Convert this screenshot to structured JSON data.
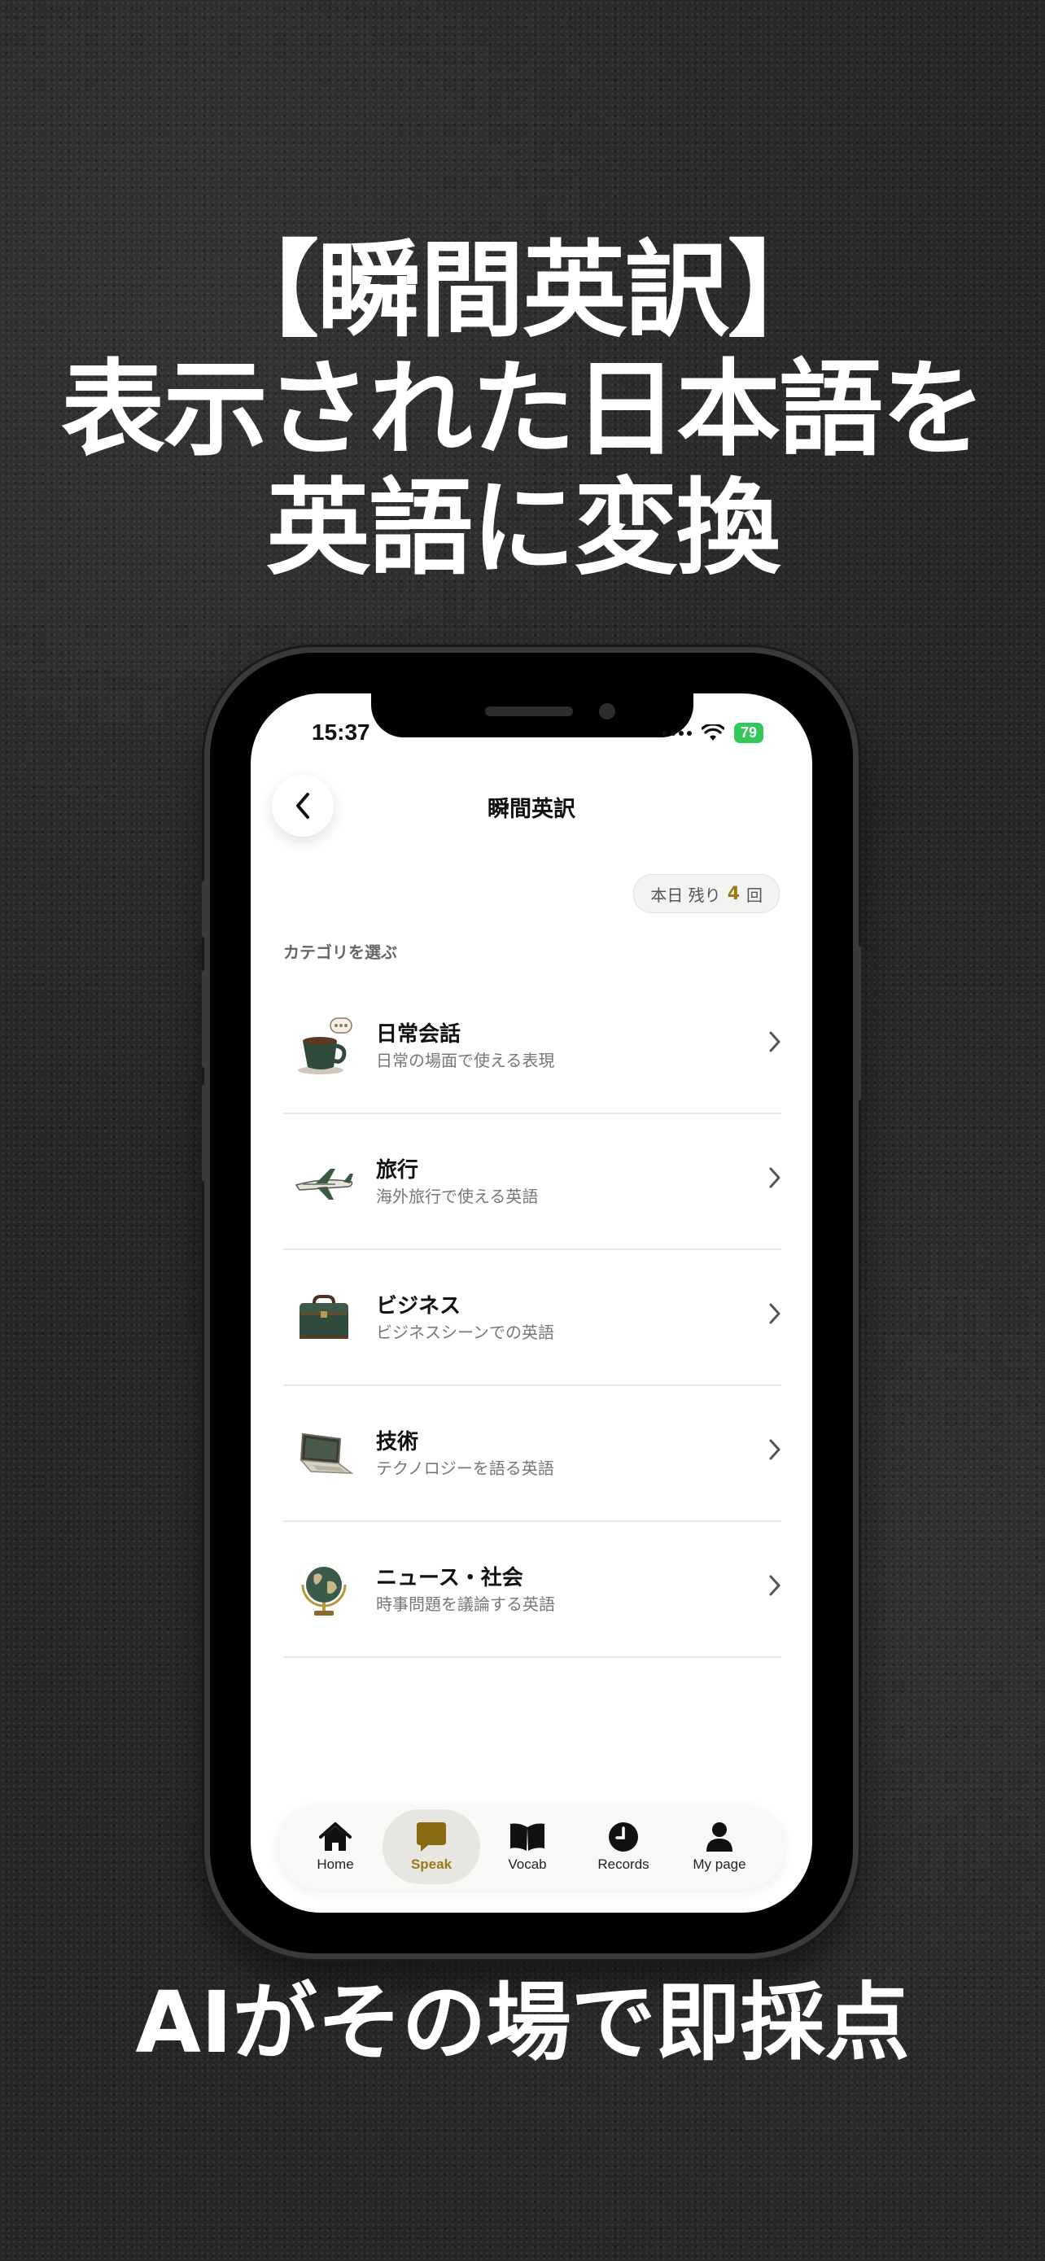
{
  "promo": {
    "headline_lines": [
      "【瞬間英訳】",
      "表示された日本語を",
      "英語に変換"
    ],
    "footer": "AIがその場で即採点"
  },
  "status_bar": {
    "time": "15:37",
    "battery": "79"
  },
  "nav": {
    "title": "瞬間英訳"
  },
  "remaining": {
    "prefix": "本日 残り",
    "count": "4",
    "suffix": "回"
  },
  "section_label": "カテゴリを選ぶ",
  "categories": [
    {
      "title": "日常会話",
      "subtitle": "日常の場面で使える表現",
      "icon": "coffee-cup-icon"
    },
    {
      "title": "旅行",
      "subtitle": "海外旅行で使える英語",
      "icon": "airplane-icon"
    },
    {
      "title": "ビジネス",
      "subtitle": "ビジネスシーンでの英語",
      "icon": "briefcase-icon"
    },
    {
      "title": "技術",
      "subtitle": "テクノロジーを語る英語",
      "icon": "laptop-icon"
    },
    {
      "title": "ニュース・社会",
      "subtitle": "時事問題を議論する英語",
      "icon": "globe-icon"
    }
  ],
  "tabs": [
    {
      "label": "Home",
      "icon": "home-icon",
      "active": false
    },
    {
      "label": "Speak",
      "icon": "speech-bubble-icon",
      "active": true
    },
    {
      "label": "Vocab",
      "icon": "book-icon",
      "active": false
    },
    {
      "label": "Records",
      "icon": "clock-icon",
      "active": false
    },
    {
      "label": "My page",
      "icon": "person-icon",
      "active": false
    }
  ],
  "colors": {
    "accent": "#9a7a18",
    "background": "#262626",
    "battery": "#34c759"
  }
}
